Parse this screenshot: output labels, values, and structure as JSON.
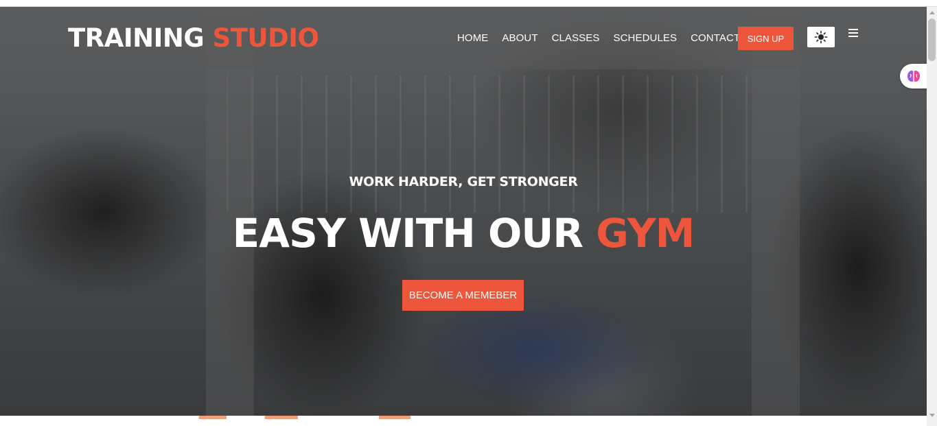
{
  "header": {
    "logo_primary": "TRAINING",
    "logo_accent": "STUDIO",
    "nav": [
      "HOME",
      "ABOUT",
      "CLASSES",
      "SCHEDULES",
      "CONTACT"
    ],
    "signup_label": "SIGN UP"
  },
  "hero": {
    "tagline": "WORK HARDER, GET STRONGER",
    "headline_primary": "EASY WITH OUR",
    "headline_accent": "GYM",
    "cta_label": "BECOME A MEMEBER"
  },
  "icons": {
    "theme_toggle": "sun-icon",
    "menu": "hamburger-menu-icon",
    "side_widget": "brain-icon"
  },
  "colors": {
    "accent": "#ed563b",
    "text": "#ffffff"
  }
}
